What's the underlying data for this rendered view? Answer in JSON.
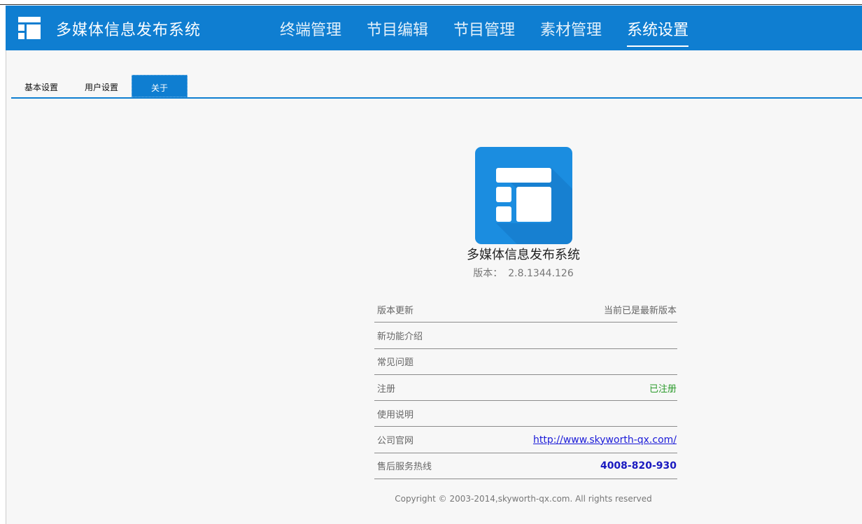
{
  "app": {
    "title": "多媒体信息发布系统"
  },
  "nav": {
    "items": [
      {
        "label": "终端管理"
      },
      {
        "label": "节目编辑"
      },
      {
        "label": "节目管理"
      },
      {
        "label": "素材管理"
      },
      {
        "label": "系统设置"
      }
    ],
    "active": "系统设置"
  },
  "tabs": {
    "items": [
      {
        "label": "基本设置"
      },
      {
        "label": "用户设置"
      },
      {
        "label": "关于"
      }
    ],
    "active": "关于"
  },
  "about": {
    "name": "多媒体信息发布系统",
    "version_label": "版本：",
    "version_value": "2.8.1344.126",
    "rows": [
      {
        "label": "版本更新",
        "value": "当前已是最新版本"
      },
      {
        "label": "新功能介绍",
        "value": ""
      },
      {
        "label": "常见问题",
        "value": ""
      },
      {
        "label": "注册",
        "value": "已注册"
      },
      {
        "label": "使用说明",
        "value": ""
      },
      {
        "label": "公司官网",
        "value": "http://www.skyworth-qx.com/"
      },
      {
        "label": "售后服务热线",
        "value": "4008-820-930"
      }
    ],
    "copyright": "Copyright ©  2003-2014,skyworth-qx.com. All rights reserved"
  },
  "colors": {
    "brand": "#0f7ed1",
    "registered": "#2a9a2a",
    "link": "#1a1ad8"
  },
  "icons": {
    "logo": "layout-logo-icon",
    "app_icon": "layout-app-icon"
  }
}
